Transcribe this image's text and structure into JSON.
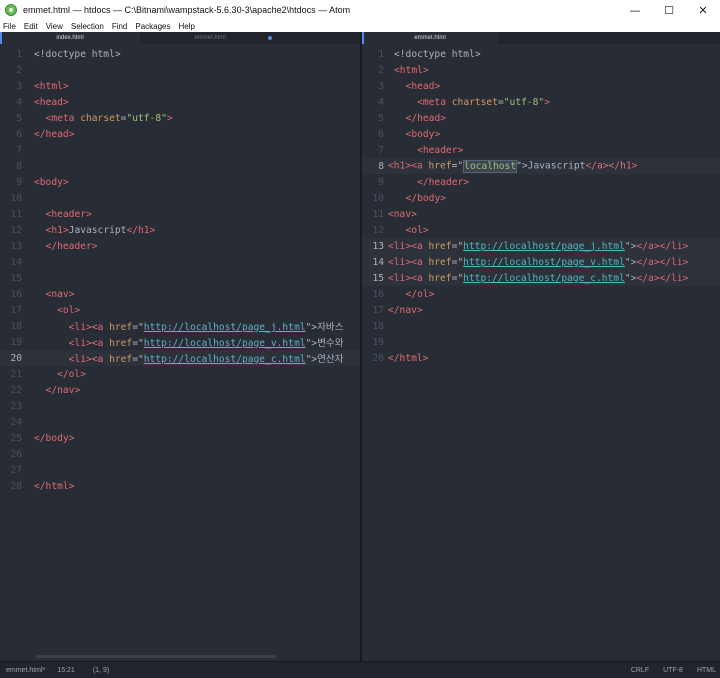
{
  "window": {
    "title": "emmet.html — htdocs — C:\\Bitnami\\wampstack-5.6.30-3\\apache2\\htdocs — Atom",
    "minimize": "—",
    "maximize": "☐",
    "close": "✕"
  },
  "menu": [
    "File",
    "Edit",
    "View",
    "Selection",
    "Find",
    "Packages",
    "Help"
  ],
  "left_pane": {
    "tabs": [
      {
        "label": "index.html",
        "active": true
      },
      {
        "label": "emmet.html",
        "active": false,
        "modified": true
      }
    ]
  },
  "right_pane": {
    "tabs": [
      {
        "label": "emmet.html",
        "active": true
      }
    ]
  },
  "left_lines": [
    "1",
    "2",
    "3",
    "4",
    "5",
    "6",
    "7",
    "8",
    "9",
    "10",
    "11",
    "12",
    "13",
    "14",
    "15",
    "16",
    "17",
    "18",
    "19",
    "20",
    "21",
    "22",
    "23",
    "24",
    "25",
    "26",
    "27",
    "28"
  ],
  "right_lines": [
    "1",
    "2",
    "3",
    "4",
    "5",
    "6",
    "7",
    "8",
    "9",
    "10",
    "11",
    "12",
    "13",
    "14",
    "15",
    "16",
    "17",
    "18",
    "19",
    "20"
  ],
  "left_code": {
    "doctype": "<!doctype html>",
    "html_open": "<html>",
    "head_open": "<head>",
    "meta": "<meta",
    "charset_attr": "charset",
    "charset_val": "\"utf-8\"",
    "head_close": "</head>",
    "body_open": "<body>",
    "header_open": "<header>",
    "h1_open": "<h1>",
    "h1_text": "Javascript",
    "h1_close": "</h1>",
    "header_close": "</header>",
    "nav_open": "<nav>",
    "ol_open": "<ol>",
    "li_open": "<li>",
    "a_open": "<a",
    "href_attr": "href",
    "url_j": "http://localhost/page_j.html",
    "url_v": "http://localhost/page_v.html",
    "url_c": "http://localhost/page_c.html",
    "text_j": "자바스",
    "text_v": "변수와",
    "text_c": "연산자",
    "ol_close": "</ol>",
    "nav_close": "</nav>",
    "body_close": "</body>",
    "html_close": "</html>"
  },
  "right_code": {
    "doctype": "<!doctype html>",
    "html_open": "<html>",
    "head_open": "<head>",
    "meta": "<meta",
    "chartset_attr": "chartset",
    "charset_val": "\"utf-8\"",
    "head_close": "</head>",
    "body_open": "<body>",
    "header_open": "<header>",
    "h1_open": "<h1>",
    "a_open": "<a",
    "href_attr": "href",
    "localhost": "localhost",
    "h1_text": "Javascript",
    "a_close": "</a>",
    "h1_close": "</h1>",
    "header_close": "</header>",
    "body_close": "</body>",
    "nav_open": "<nav>",
    "ol_open": "<ol>",
    "li_open": "<li>",
    "url_j": "http://localhost/page_j.html",
    "url_v": "http://localhost/page_v.html",
    "url_c": "http://localhost/page_c.html",
    "li_close": "</li>",
    "ol_close": "</ol>",
    "nav_close": "</nav>",
    "html_close": "</html>"
  },
  "status": {
    "file": "emmet.html*",
    "position": "15:21",
    "selection": "(1, 9)",
    "line_ending": "CRLF",
    "encoding": "UTF-8",
    "grammar": "HTML"
  },
  "colors": {
    "background": "#282c34",
    "tag": "#e06c75",
    "attribute": "#d19a66",
    "string": "#98c379",
    "link": "#56b6c2",
    "accent": "#568af2"
  }
}
